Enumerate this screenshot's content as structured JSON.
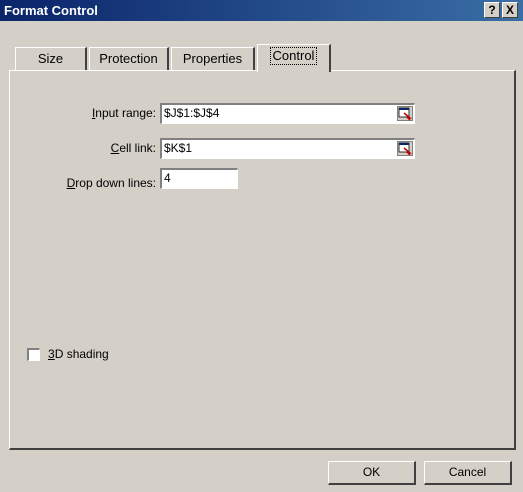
{
  "window": {
    "title": "Format Control",
    "help_label": "?",
    "close_label": "X"
  },
  "tabs": [
    {
      "label": "Size"
    },
    {
      "label": "Protection"
    },
    {
      "label": "Properties"
    },
    {
      "label": "Control",
      "active": true
    }
  ],
  "control": {
    "input_range": {
      "label_prefix": "I",
      "label_rest": "nput range:",
      "value": "$J$1:$J$4",
      "ref_icon": "collapse-dialog-icon"
    },
    "cell_link": {
      "label_prefix": "C",
      "label_rest": "ell link:",
      "value": "$K$1",
      "ref_icon": "collapse-dialog-icon"
    },
    "drop_down_lines": {
      "label_prefix": "D",
      "label_rest": "rop down lines:",
      "value": "4"
    },
    "shading": {
      "label_prefix": "3",
      "label_rest": "D shading",
      "checked": false
    }
  },
  "buttons": {
    "ok": "OK",
    "cancel": "Cancel"
  }
}
